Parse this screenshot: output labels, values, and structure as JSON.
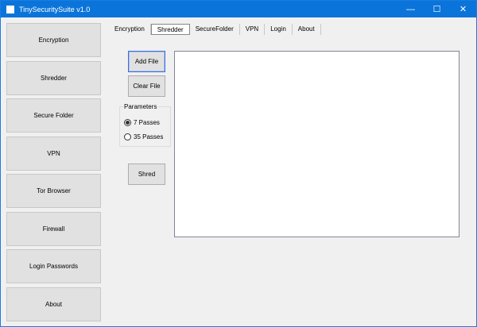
{
  "window": {
    "title": "TinySecuritySuite v1.0",
    "minimize": "—",
    "maximize": "☐",
    "close": "✕"
  },
  "sidebar": {
    "items": [
      {
        "label": "Encryption"
      },
      {
        "label": "Shredder"
      },
      {
        "label": "Secure Folder"
      },
      {
        "label": "VPN"
      },
      {
        "label": "Tor Browser"
      },
      {
        "label": "Firewall"
      },
      {
        "label": "Login Passwords"
      },
      {
        "label": "About"
      }
    ]
  },
  "tabs": [
    {
      "label": "Encryption"
    },
    {
      "label": "Shredder",
      "active": true
    },
    {
      "label": "SecureFolder"
    },
    {
      "label": "VPN"
    },
    {
      "label": "Login"
    },
    {
      "label": "About"
    }
  ],
  "shredder": {
    "add_file": "Add File",
    "clear_file": "Clear File",
    "parameters_label": "Parameters",
    "options": [
      {
        "label": "7 Passes",
        "checked": true
      },
      {
        "label": "35 Passes",
        "checked": false
      }
    ],
    "shred": "Shred"
  }
}
